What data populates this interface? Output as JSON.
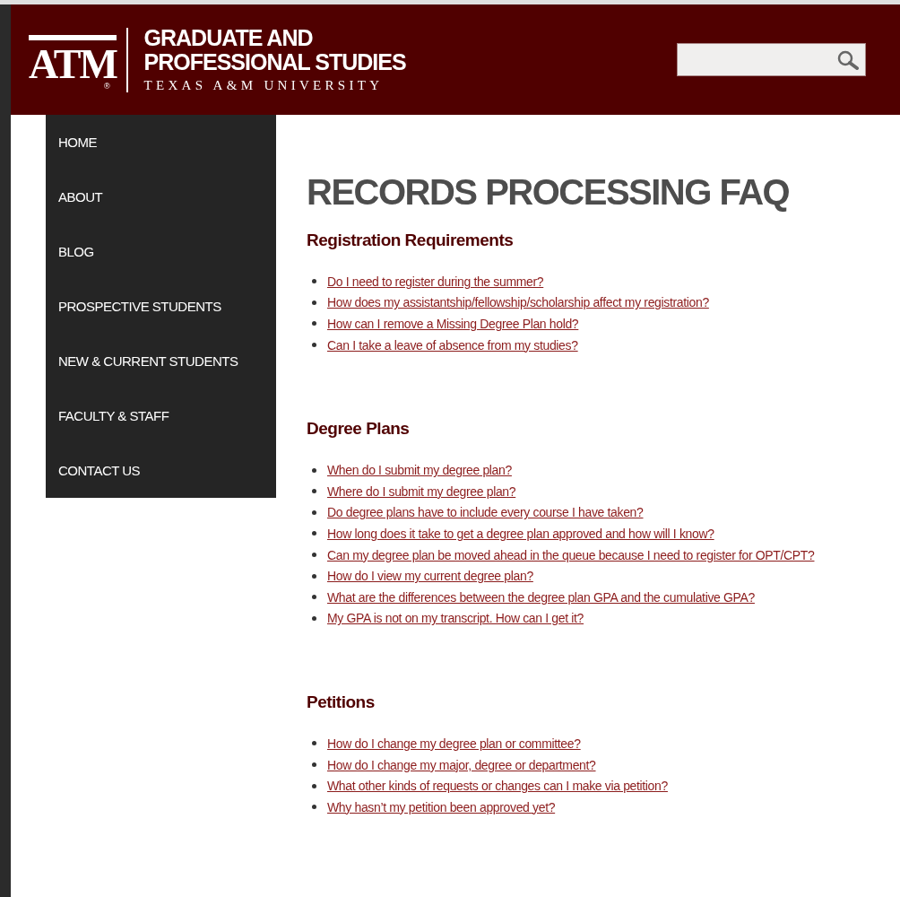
{
  "header": {
    "logo": {
      "letters": "ATM",
      "mark": "®"
    },
    "title_lines": [
      "GRADUATE AND",
      "PROFESSIONAL STUDIES"
    ],
    "subtitle": "TEXAS A&M UNIVERSITY"
  },
  "sidebar": {
    "items": [
      "HOME",
      "ABOUT",
      "BLOG",
      "PROSPECTIVE STUDENTS",
      "NEW & CURRENT STUDENTS",
      "FACULTY & STAFF",
      "CONTACT US"
    ]
  },
  "page_title": "RECORDS PROCESSING FAQ",
  "sections": [
    {
      "heading": "Registration Requirements",
      "links": [
        "Do I need to register during the summer?",
        "How does my assistantship/fellowship/scholarship affect my registration?",
        "How can I remove a Missing Degree Plan hold?",
        "Can I take a leave of absence from my studies?"
      ]
    },
    {
      "heading": "Degree Plans",
      "links": [
        "When do I submit my degree plan?",
        "Where do I submit my degree plan?",
        "Do degree plans have to include every course I have taken?",
        "How long does it take to get a degree plan approved and how will I know?",
        "Can my degree plan be moved ahead in the queue because I need to register for OPT/CPT?",
        "How do I view my current degree plan?",
        "What are the differences between the degree plan GPA and the cumulative GPA?",
        "My GPA is not on my transcript. How can I get it?"
      ]
    },
    {
      "heading": "Petitions",
      "links": [
        "How do I change my degree plan or committee?",
        "How do I change my major, degree or department?",
        "What other kinds of requests or changes can I make via petition?",
        "Why hasn’t my petition been approved yet?"
      ]
    }
  ]
}
